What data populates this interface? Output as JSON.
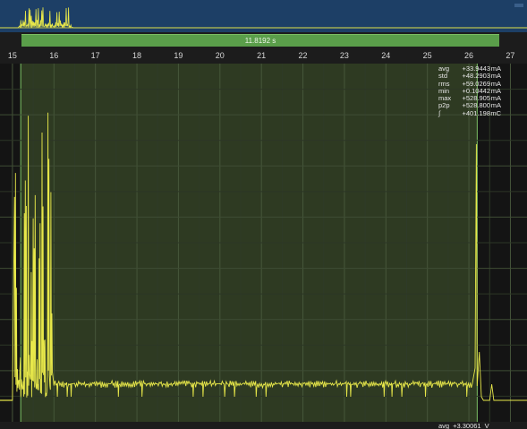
{
  "selection": {
    "duration": "11.8192 s"
  },
  "timeline": {
    "ticks": [
      "15",
      "16",
      "17",
      "18",
      "19",
      "20",
      "21",
      "22",
      "23",
      "24",
      "25",
      "26",
      "27"
    ],
    "range": [
      14.7,
      27.4
    ],
    "selection_range": [
      15.2,
      26.2
    ]
  },
  "current_stats": [
    {
      "k": "avg",
      "v": "+33.9443",
      "u": "mA"
    },
    {
      "k": "std",
      "v": "+48.2903",
      "u": "mA"
    },
    {
      "k": "rms",
      "v": "+59.0269",
      "u": "mA"
    },
    {
      "k": "min",
      "v": "+0.10442",
      "u": "mA"
    },
    {
      "k": "max",
      "v": "+528.905",
      "u": "mA"
    },
    {
      "k": "p2p",
      "v": "+528.800",
      "u": "mA"
    },
    {
      "k": "∫",
      "v": "+401.198",
      "u": "mC"
    }
  ],
  "voltage": {
    "label": "avg",
    "value": "+3.30061",
    "unit": "V"
  },
  "colors": {
    "trace": "#e8e84a",
    "overview_bg": "#1d3f66",
    "selection": "#5a9e4a",
    "plot_bg": "#141414",
    "selected_bg": "#2e3a22",
    "grid": "#3b4a32"
  }
}
